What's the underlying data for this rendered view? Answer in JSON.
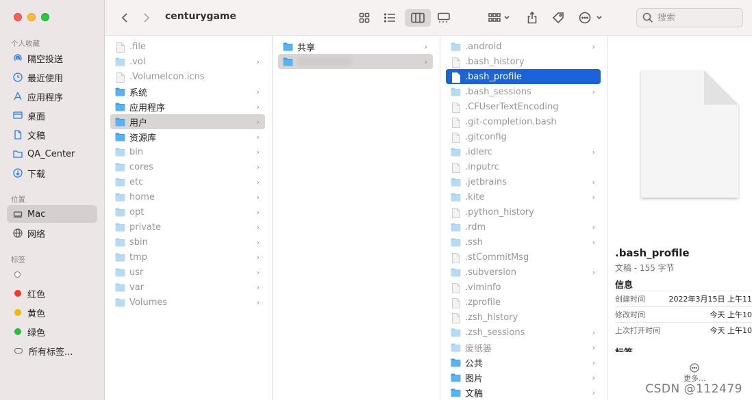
{
  "window": {
    "controls": [
      "close",
      "minimize",
      "zoom"
    ]
  },
  "sidebar": {
    "favorites_title": "个人收藏",
    "favorites": [
      {
        "label": "隔空投送",
        "icon": "airdrop-icon"
      },
      {
        "label": "最近使用",
        "icon": "clock-icon"
      },
      {
        "label": "应用程序",
        "icon": "applications-icon"
      },
      {
        "label": "桌面",
        "icon": "desktop-icon"
      },
      {
        "label": "文稿",
        "icon": "document-icon"
      },
      {
        "label": "QA_Center",
        "icon": "folder-icon"
      },
      {
        "label": "下载",
        "icon": "download-icon"
      }
    ],
    "locations_title": "位置",
    "locations": [
      {
        "label": "Mac",
        "icon": "computer-icon",
        "active": true
      },
      {
        "label": "网络",
        "icon": "globe-icon"
      }
    ],
    "tags_title": "标签",
    "tags": [
      {
        "label": "",
        "color": "#ffffff"
      },
      {
        "label": "红色",
        "color": "#f2372f"
      },
      {
        "label": "黄色",
        "color": "#f4b400"
      },
      {
        "label": "绿色",
        "color": "#2aba3c"
      },
      {
        "label": "所有标签...",
        "color": "none"
      }
    ]
  },
  "toolbar": {
    "title": "centurygame",
    "back_icon": "chevron-left-icon",
    "forward_icon": "chevron-right-icon",
    "search_placeholder": "搜索"
  },
  "columns": [
    {
      "items": [
        {
          "name": ".file",
          "type": "file",
          "dim": true,
          "chevron": false
        },
        {
          "name": ".vol",
          "type": "folder",
          "dim": true,
          "chevron": true
        },
        {
          "name": ".VolumeIcon.icns",
          "type": "file",
          "dim": true,
          "chevron": false
        },
        {
          "name": "系统",
          "type": "folder",
          "dim": false,
          "chevron": true
        },
        {
          "name": "应用程序",
          "type": "folder",
          "dim": false,
          "chevron": true
        },
        {
          "name": "用户",
          "type": "folder",
          "dim": false,
          "chevron": true,
          "selected": "gray"
        },
        {
          "name": "资源库",
          "type": "folder",
          "dim": false,
          "chevron": true
        },
        {
          "name": "bin",
          "type": "folder",
          "dim": true,
          "chevron": true
        },
        {
          "name": "cores",
          "type": "folder",
          "dim": true,
          "chevron": true
        },
        {
          "name": "etc",
          "type": "folder",
          "dim": true,
          "chevron": true
        },
        {
          "name": "home",
          "type": "folder",
          "dim": true,
          "chevron": true
        },
        {
          "name": "opt",
          "type": "folder",
          "dim": true,
          "chevron": true
        },
        {
          "name": "private",
          "type": "folder",
          "dim": true,
          "chevron": true
        },
        {
          "name": "sbin",
          "type": "folder",
          "dim": true,
          "chevron": true
        },
        {
          "name": "tmp",
          "type": "folder",
          "dim": true,
          "chevron": true
        },
        {
          "name": "usr",
          "type": "folder",
          "dim": true,
          "chevron": true
        },
        {
          "name": "var",
          "type": "folder",
          "dim": true,
          "chevron": true
        },
        {
          "name": "Volumes",
          "type": "folder",
          "dim": true,
          "chevron": true
        }
      ]
    },
    {
      "items": [
        {
          "name": "共享",
          "type": "folder",
          "dim": false,
          "chevron": true
        },
        {
          "name": "",
          "type": "folder",
          "dim": false,
          "chevron": true,
          "selected": "gray",
          "redacted": true
        }
      ]
    },
    {
      "items": [
        {
          "name": ".android",
          "type": "folder",
          "dim": true,
          "chevron": true
        },
        {
          "name": ".bash_history",
          "type": "file",
          "dim": true,
          "chevron": false
        },
        {
          "name": ".bash_profile",
          "type": "file",
          "dim": false,
          "chevron": false,
          "selected": "blue"
        },
        {
          "name": ".bash_sessions",
          "type": "folder",
          "dim": true,
          "chevron": true
        },
        {
          "name": ".CFUserTextEncoding",
          "type": "file",
          "dim": true,
          "chevron": false
        },
        {
          "name": ".git-completion.bash",
          "type": "file",
          "dim": true,
          "chevron": false
        },
        {
          "name": ".gitconfig",
          "type": "file",
          "dim": true,
          "chevron": false
        },
        {
          "name": ".idlerc",
          "type": "folder",
          "dim": true,
          "chevron": true
        },
        {
          "name": ".inputrc",
          "type": "file",
          "dim": true,
          "chevron": false
        },
        {
          "name": ".jetbrains",
          "type": "folder",
          "dim": true,
          "chevron": true
        },
        {
          "name": ".kite",
          "type": "folder",
          "dim": true,
          "chevron": true
        },
        {
          "name": ".python_history",
          "type": "file",
          "dim": true,
          "chevron": false
        },
        {
          "name": ".rdm",
          "type": "folder",
          "dim": true,
          "chevron": true
        },
        {
          "name": ".ssh",
          "type": "folder",
          "dim": true,
          "chevron": true
        },
        {
          "name": ".stCommitMsg",
          "type": "file",
          "dim": true,
          "chevron": false
        },
        {
          "name": ".subversion",
          "type": "folder",
          "dim": true,
          "chevron": true
        },
        {
          "name": ".viminfo",
          "type": "file",
          "dim": true,
          "chevron": false
        },
        {
          "name": ".zprofile",
          "type": "file",
          "dim": true,
          "chevron": false
        },
        {
          "name": ".zsh_history",
          "type": "file",
          "dim": true,
          "chevron": false
        },
        {
          "name": ".zsh_sessions",
          "type": "folder",
          "dim": true,
          "chevron": true
        },
        {
          "name": "废纸篓",
          "type": "folder",
          "dim": true,
          "chevron": true
        },
        {
          "name": "公共",
          "type": "folder",
          "dim": false,
          "chevron": true
        },
        {
          "name": "图片",
          "type": "folder",
          "dim": false,
          "chevron": true
        },
        {
          "name": "文稿",
          "type": "folder",
          "dim": false,
          "chevron": true
        }
      ]
    }
  ],
  "preview": {
    "name": ".bash_profile",
    "kind": "文稿 - 155 字节",
    "info_title": "信息",
    "rows": [
      {
        "key": "创建时间",
        "value": "2022年3月15日 上午11"
      },
      {
        "key": "修改时间",
        "value": "今天 上午10"
      },
      {
        "key": "上次打开时间",
        "value": "今天 上午10"
      }
    ],
    "tags_title": "标签",
    "more_label": "更多..."
  },
  "watermark": "CSDN @112479"
}
